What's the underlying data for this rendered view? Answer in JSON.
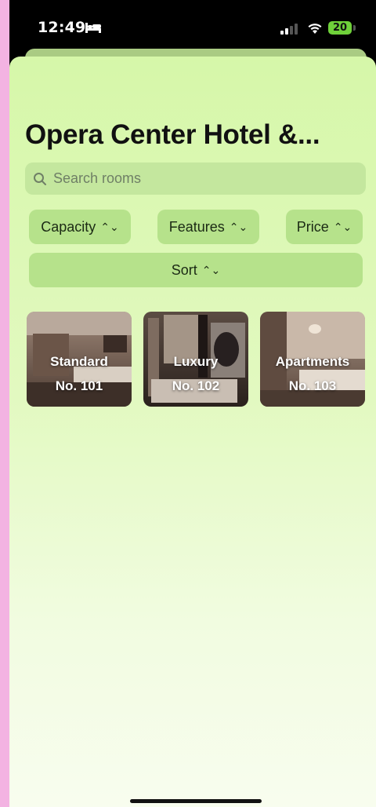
{
  "status_bar": {
    "time": "12:49",
    "battery": "20",
    "icons": [
      "bed-icon",
      "signal-icon",
      "wifi-icon",
      "battery-icon"
    ]
  },
  "header": {
    "title": "Opera Center Hotel &..."
  },
  "search": {
    "placeholder": "Search rooms",
    "icon": "search-icon"
  },
  "filters": {
    "capacity": "Capacity",
    "features": "Features",
    "price": "Price",
    "sort": "Sort",
    "chevron": "up-down-chevron-icon"
  },
  "rooms": [
    {
      "type": "Standard",
      "number": "No. 101"
    },
    {
      "type": "Luxury",
      "number": "No. 102"
    },
    {
      "type": "Apartments",
      "number": "No. 103"
    }
  ],
  "colors": {
    "sheet_top": "#d6f7a9",
    "chip": "#b6e28b",
    "search_bg": "#c4e79e",
    "outer_bg": "#f3b3e2"
  }
}
